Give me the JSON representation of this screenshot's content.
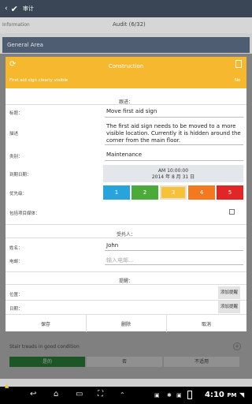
{
  "appbar": {
    "title": "审计"
  },
  "subbar": {
    "left": "Information",
    "center": "Audit (6/32)"
  },
  "general_area": "General Area",
  "dialog": {
    "title": "Construction",
    "subtitle": "First aid sign clearly visible",
    "status": "No",
    "followup_header": "跟进：",
    "fields": {
      "title_label": "标题：",
      "title_value": "Move first aid sign",
      "desc_label": "描述",
      "desc_value": "The first aid sign needs to be moved to a more visible location. Currently it is hidden around the corner from the main floor.",
      "category_label": "类别：",
      "category_value": "Maintenance",
      "due_label": "到期日期：",
      "due_time": "AM 10:00:00",
      "due_date": "2014 年 8 月 31 日",
      "priority_label": "优先级：",
      "priorities": [
        "1",
        "2",
        "3",
        "4",
        "5"
      ],
      "media_label": "包括项目媒体："
    },
    "assignee_header": "受托人：",
    "assignee": {
      "name_label": "姓名：",
      "name_value": "John",
      "email_label": "电邮：",
      "email_placeholder": "输入电邮..."
    },
    "reminder_header": "提醒：",
    "reminder": {
      "location_label": "位置：",
      "date_label": "日期：",
      "add_label": "添加提醒"
    },
    "footer": {
      "save": "保存",
      "delete": "删除",
      "cancel": "取消"
    }
  },
  "bottom": {
    "question": "Stair treads in good condition",
    "options": [
      "是的",
      "否",
      "不适用"
    ]
  },
  "navbar": {
    "time": "4:10",
    "ampm": "PM"
  }
}
